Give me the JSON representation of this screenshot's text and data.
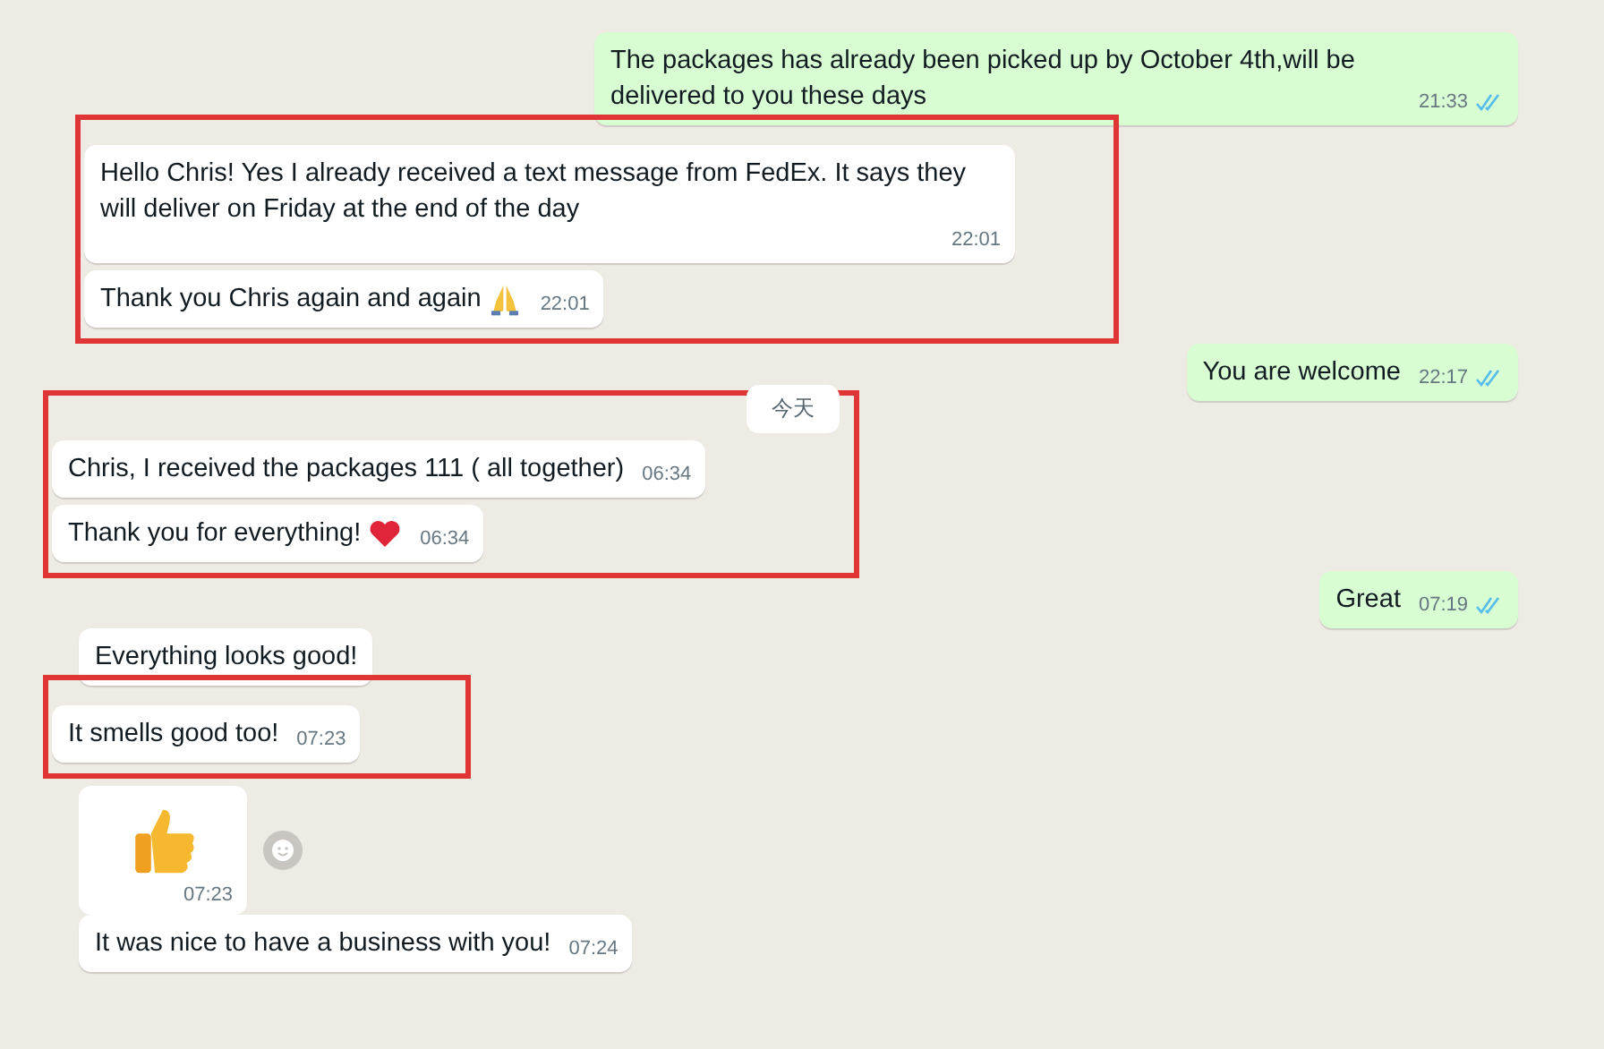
{
  "items": [
    {
      "kind": "sent",
      "text": "The packages has already been picked up by October 4th,will be delivered to you these days",
      "time": "21:33",
      "read": true
    },
    {
      "kind": "group",
      "highlighted": true,
      "messages": [
        {
          "kind": "received",
          "text": "Hello Chris! Yes I already received a text message from FedEx. It says they will deliver on Friday at the end of the day",
          "time": "22:01"
        },
        {
          "kind": "received",
          "text": "Thank you Chris again and again",
          "pray_emoji": true,
          "time": "22:01"
        }
      ]
    },
    {
      "kind": "sent",
      "text": "You are welcome",
      "time": "22:17",
      "read": true
    },
    {
      "kind": "group",
      "highlighted": true,
      "messages": [
        {
          "kind": "date",
          "text": "今天"
        },
        {
          "kind": "received",
          "text": "Chris, I received the packages 111 ( all together)",
          "time": "06:34"
        },
        {
          "kind": "received",
          "text": "Thank you for everything!",
          "heart_emoji": true,
          "time": "06:34"
        }
      ]
    },
    {
      "kind": "sent",
      "text": "Great",
      "time": "07:19",
      "read": true
    },
    {
      "kind": "received",
      "text": "Everything looks good!"
    },
    {
      "kind": "group",
      "highlighted": true,
      "messages": [
        {
          "kind": "received",
          "text": "It smells good too!",
          "time": "07:23"
        }
      ]
    },
    {
      "kind": "sticker",
      "time": "07:23",
      "reaction_button": true
    },
    {
      "kind": "received",
      "text": "It was nice to have a business with you!",
      "time": "07:24"
    }
  ]
}
